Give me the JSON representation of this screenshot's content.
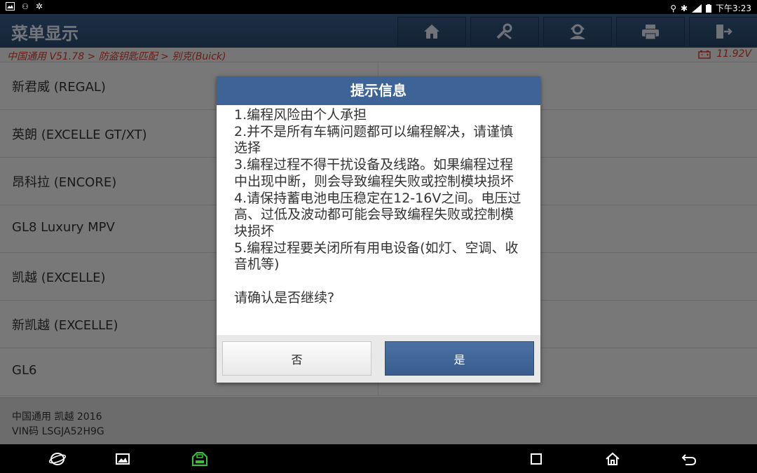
{
  "statusbar": {
    "time": "下午3:23"
  },
  "header": {
    "title": "菜单显示"
  },
  "toolbar": [
    "home-icon",
    "diagnose-icon",
    "user-icon",
    "print-icon",
    "exit-icon"
  ],
  "breadcrumb": {
    "path": "中国通用 V51.78 > 防盗钥匙匹配 > 别克(Buick)",
    "voltage": "11.92V"
  },
  "list": [
    {
      "label": "新君威 (REGAL)"
    },
    {
      "label": "英朗 (EXCELLE GT/XT)"
    },
    {
      "label": "昂科拉 (ENCORE)"
    },
    {
      "label": "GL8 Luxury MPV"
    },
    {
      "label": "凯越 (EXCELLE)"
    },
    {
      "label": "新凯越 (EXCELLE)"
    },
    {
      "label": "GL6"
    }
  ],
  "footer": {
    "vehicle": "中国通用 凯越 2016",
    "vin": "VIN码 LSGJA52H9G"
  },
  "dialog": {
    "title": "提示信息",
    "lines": [
      "1.编程风险由个人承担",
      "2.并不是所有车辆问题都可以编程解决，请谨慎选择",
      "3.编程过程不得干扰设备及线路。如果编程过程中出现中断，则会导致编程失败或控制模块损坏",
      "4.请保持蓄电池电压稳定在12-16V之间。电压过高、过低及波动都可能会导致编程失败或控制模块损坏",
      "5.编程过程要关闭所有用电设备(如灯、空调、收音机等)"
    ],
    "question": "请确认是否继续?",
    "no_label": "否",
    "yes_label": "是"
  },
  "colors": {
    "header": "#2f4f78",
    "accent_red": "#d43a2a",
    "dialog_title": "#3e6396"
  }
}
